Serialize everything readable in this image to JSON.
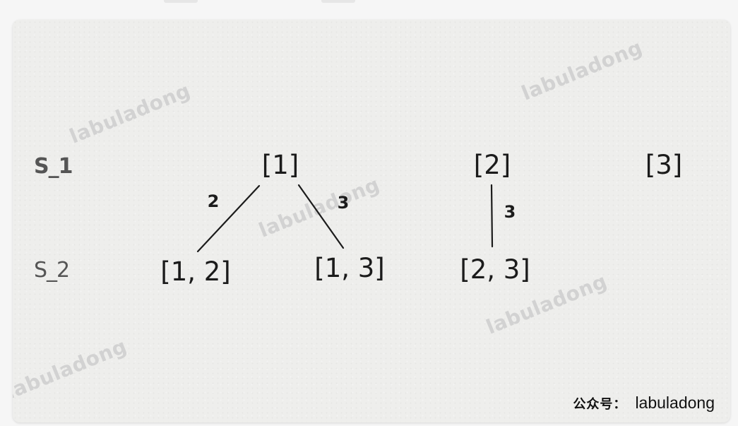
{
  "levels": [
    {
      "label": "S_1",
      "bold": true
    },
    {
      "label": "S_2",
      "bold": false
    }
  ],
  "nodes": {
    "n1": "[1]",
    "n2": "[2]",
    "n3": "[3]",
    "n12": "[1, 2]",
    "n13": "[1, 3]",
    "n23": "[2, 3]"
  },
  "edges": [
    {
      "from": "[1]",
      "to": "[1, 2]",
      "label": "2"
    },
    {
      "from": "[1]",
      "to": "[1, 3]",
      "label": "3"
    },
    {
      "from": "[2]",
      "to": "[2, 3]",
      "label": "3"
    }
  ],
  "watermark": "labuladong",
  "credit": {
    "prefix": "公众号：",
    "name": "labuladong"
  }
}
